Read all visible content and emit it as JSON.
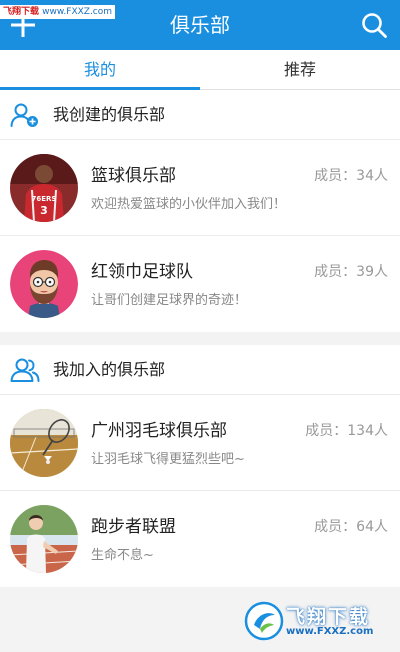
{
  "watermark_top": {
    "brand": "飞翔下载",
    "url": "www.FXXZ.com"
  },
  "header": {
    "title": "俱乐部"
  },
  "tabs": [
    {
      "label": "我的",
      "active": true
    },
    {
      "label": "推荐",
      "active": false
    }
  ],
  "created_section": {
    "title": "我创建的俱乐部",
    "clubs": [
      {
        "name": "篮球俱乐部",
        "members": "成员：34人",
        "desc": "欢迎热爱篮球的小伙伴加入我们！",
        "avatar": "basketball-player-avatar",
        "avatar_text": "76ERS 3"
      },
      {
        "name": "红领巾足球队",
        "members": "成员：39人",
        "desc": "让哥们创建足球界的奇迹！",
        "avatar": "bearded-cartoon-avatar"
      }
    ]
  },
  "joined_section": {
    "title": "我加入的俱乐部",
    "clubs": [
      {
        "name": "广州羽毛球俱乐部",
        "members": "成员：134人",
        "desc": "让羽毛球飞得更猛烈些吧~",
        "avatar": "badminton-court-avatar"
      },
      {
        "name": "跑步者联盟",
        "members": "成员：64人",
        "desc": "生命不息~",
        "avatar": "runner-photo-avatar"
      }
    ]
  },
  "watermark_logo": {
    "text": "飞翔下载",
    "url": "www.FXXZ.com"
  },
  "colors": {
    "primary": "#1a8fe0",
    "background": "#f3f3f3"
  }
}
